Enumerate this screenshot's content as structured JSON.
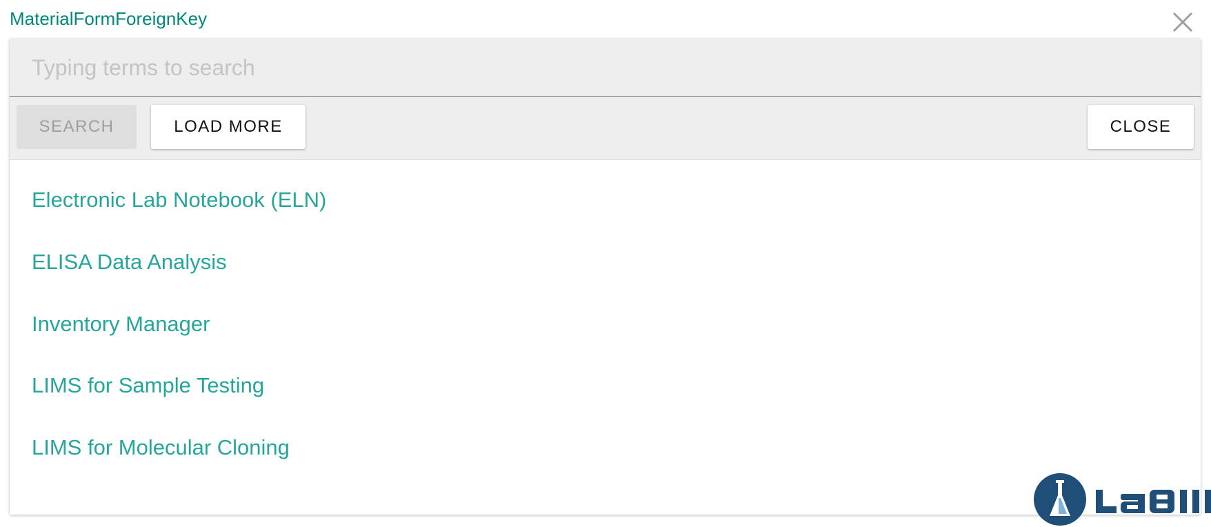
{
  "dialog": {
    "title": "MaterialFormForeignKey",
    "close_icon": "close-icon"
  },
  "search": {
    "placeholder": "Typing terms to search",
    "value": ""
  },
  "toolbar": {
    "search_label": "SEARCH",
    "load_more_label": "LOAD MORE",
    "close_label": "CLOSE"
  },
  "results": [
    {
      "label": "Electronic Lab Notebook (ELN)"
    },
    {
      "label": "ELISA Data Analysis"
    },
    {
      "label": "Inventory Manager"
    },
    {
      "label": "LIMS for Sample Testing"
    },
    {
      "label": "LIMS for Molecular Cloning"
    }
  ],
  "logo": {
    "text": "LaBII",
    "icon": "flask-icon"
  },
  "colors": {
    "accent": "#00897b",
    "result_text": "#26a69a",
    "logo_blue": "#1f4e79"
  }
}
